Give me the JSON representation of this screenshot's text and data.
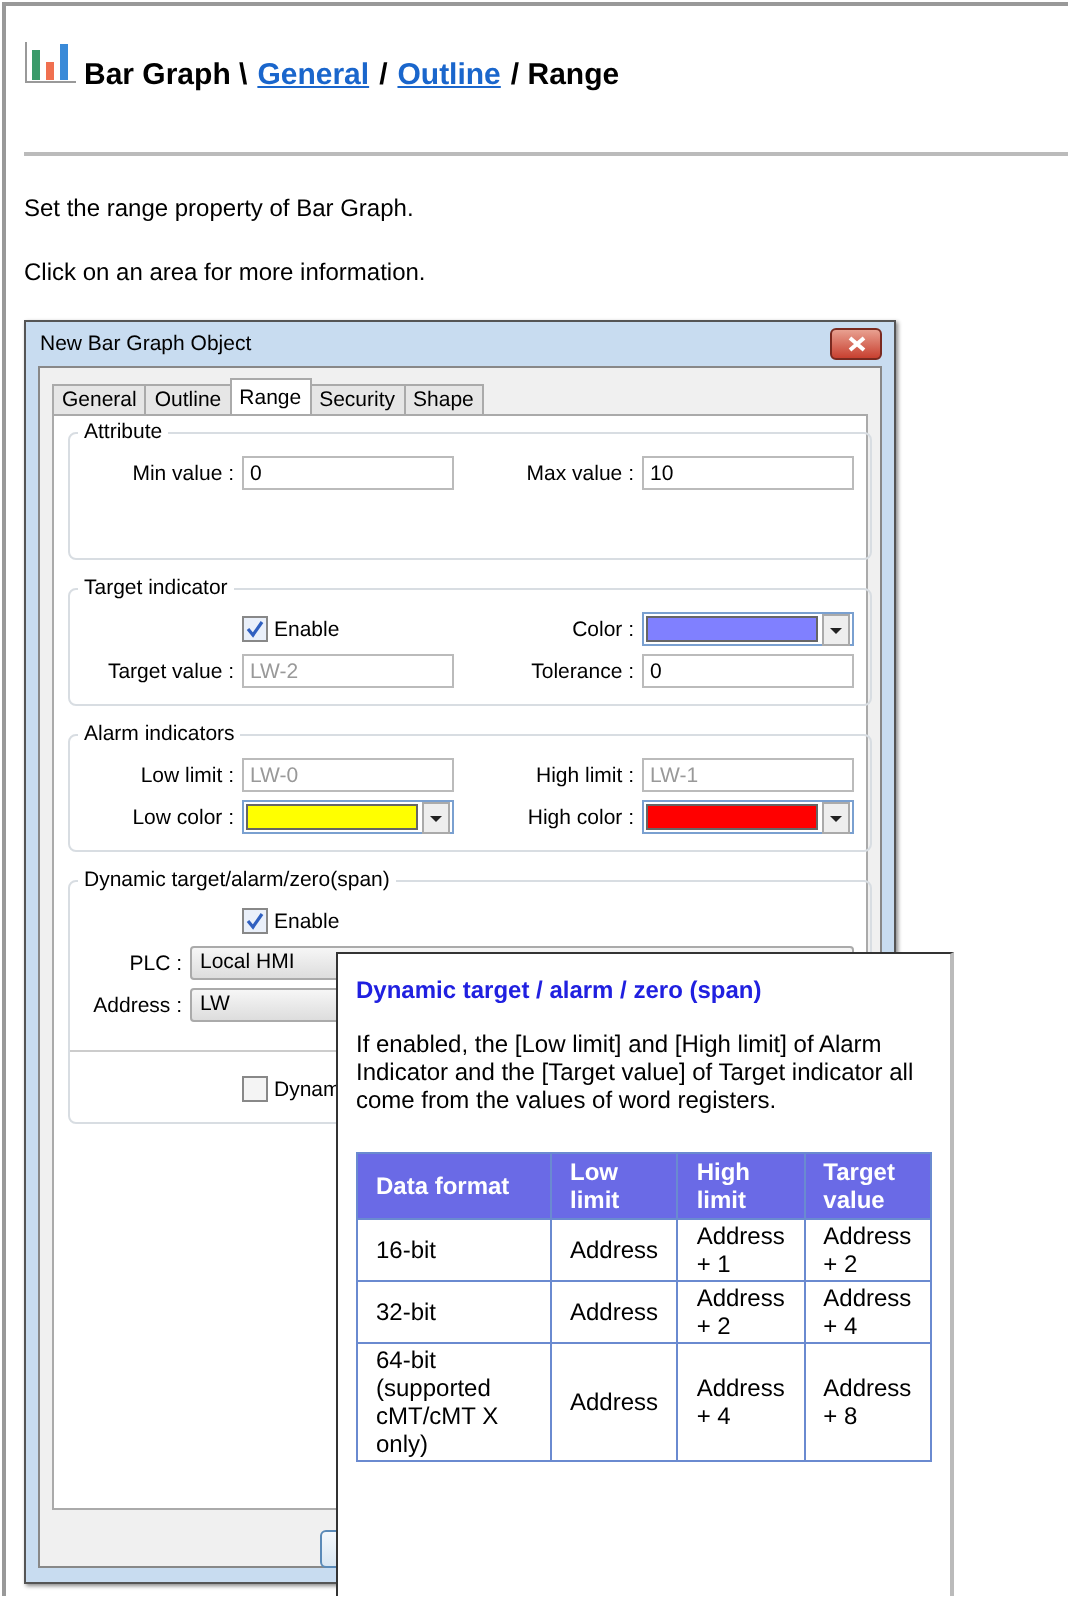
{
  "header": {
    "parts": [
      {
        "text": "Bar Graph \\",
        "link": false
      },
      {
        "text": "General",
        "link": true
      },
      {
        "text": "/",
        "link": false
      },
      {
        "text": "Outline",
        "link": true
      },
      {
        "text": "/ Range",
        "link": false
      }
    ]
  },
  "intro": [
    "Set the range property of Bar Graph.",
    "Click on an area for more information."
  ],
  "dialog": {
    "title": "New Bar Graph Object",
    "tabs": [
      {
        "label": "General",
        "selected": false
      },
      {
        "label": "Outline",
        "selected": false
      },
      {
        "label": "Range",
        "selected": true
      },
      {
        "label": "Security",
        "selected": false
      },
      {
        "label": "Shape",
        "selected": false
      }
    ],
    "groups": [
      {
        "title": "Attribute",
        "rows": [
          [
            {
              "kind": "text",
              "label": "Min value :",
              "value": "0",
              "disabled": false
            },
            {
              "kind": "text",
              "label": "Max value :",
              "value": "10",
              "disabled": false
            }
          ]
        ]
      },
      {
        "title": "Target indicator",
        "rows": [
          [
            {
              "kind": "checkbox",
              "label": "Enable",
              "checked": true
            },
            {
              "kind": "color",
              "label": "Color :",
              "color": "#8080ff"
            }
          ],
          [
            {
              "kind": "text",
              "label": "Target value :",
              "value": "LW-2",
              "disabled": true
            },
            {
              "kind": "text",
              "label": "Tolerance :",
              "value": "0",
              "disabled": false
            }
          ]
        ]
      },
      {
        "title": "Alarm indicators",
        "rows": [
          [
            {
              "kind": "text",
              "label": "Low limit :",
              "value": "LW-0",
              "disabled": true
            },
            {
              "kind": "text",
              "label": "High limit :",
              "value": "LW-1",
              "disabled": true
            }
          ],
          [
            {
              "kind": "color",
              "label": "Low color :",
              "color": "#ffff00"
            },
            {
              "kind": "color",
              "label": "High color :",
              "color": "#ff0000"
            }
          ]
        ]
      },
      {
        "title": "Dynamic target/alarm/zero(span)",
        "rows": [
          [
            {
              "kind": "checkbox",
              "label": "Enable",
              "checked": true
            }
          ],
          [
            {
              "kind": "dropdown",
              "label": "PLC :",
              "value": "Local HMI"
            }
          ],
          [
            {
              "kind": "dropdown",
              "label": "Address :",
              "value": "LW"
            }
          ],
          [
            {
              "kind": "separator"
            }
          ],
          [
            {
              "kind": "checkbox",
              "label": "Dynam",
              "checked": false
            }
          ]
        ]
      }
    ]
  },
  "popup": {
    "title": "Dynamic target / alarm / zero (span)",
    "text": "If enabled, the [Low limit] and [High limit] of Alarm Indicator and the [Target value] of Target indicator all come from the values of word registers.",
    "table": {
      "columns": [
        "Data format",
        "Low limit",
        "High limit",
        "Target value"
      ],
      "rows": [
        [
          "16-bit",
          "Address",
          "Address + 1",
          "Address + 2"
        ],
        [
          "32-bit",
          "Address",
          "Address + 2",
          "Address + 4"
        ],
        [
          "64-bit (supported cMT/cMT X only)",
          "Address",
          "Address + 4",
          "Address + 8"
        ]
      ]
    }
  }
}
